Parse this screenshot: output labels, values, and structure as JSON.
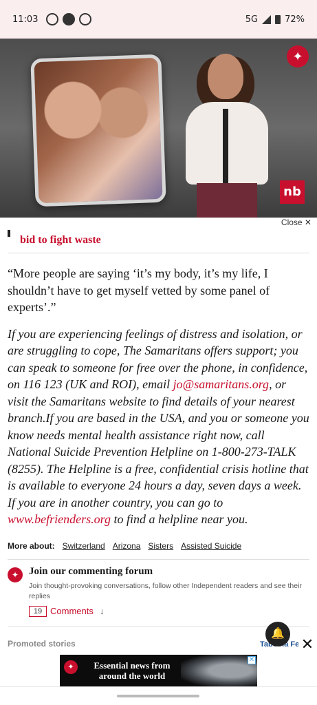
{
  "status_bar": {
    "time": "11:03",
    "network": "5G",
    "battery": "72%"
  },
  "video": {
    "nb_logo": "nb"
  },
  "close_label": "Close ✕",
  "article": {
    "related_title": "bid to fight waste",
    "quote": "“More people are saying ‘it’s my body, it’s my life, I shouldn’t have to get myself vetted by some panel of experts’.”",
    "help_text_1": "If you are experiencing feelings of distress and isolation, or are struggling to cope, The Samaritans offers support; you can speak to someone for free over the phone, in confidence, on 116 123 (UK and ROI), email ",
    "help_email": "jo@samaritans.org",
    "help_text_2": ", or visit the Samaritans website to find details of your nearest branch.If you are based in the USA, and you or someone you know needs mental health assistance right now, call National Suicide Prevention Helpline on 1-800-273-TALK (8255). The Helpline is a free, confidential crisis hotline that is available to everyone 24 hours a day, seven days a week. If you are in another country, you can go to ",
    "help_link": "www.befrienders.org",
    "help_text_3": " to find a helpline near you."
  },
  "more_about": {
    "label": "More about:",
    "tags": [
      "Switzerland",
      "Arizona",
      "Sisters",
      "Assisted Suicide"
    ]
  },
  "forum": {
    "title": "Join our commenting forum",
    "description": "Join thought-provoking conversations, follow other Independent readers and see their replies",
    "count": "19",
    "comments_label": "Comments"
  },
  "promoted": {
    "label": "Promoted stories",
    "provider": "Taboola Fe"
  },
  "ad": {
    "text": "Essential news from around the world"
  }
}
